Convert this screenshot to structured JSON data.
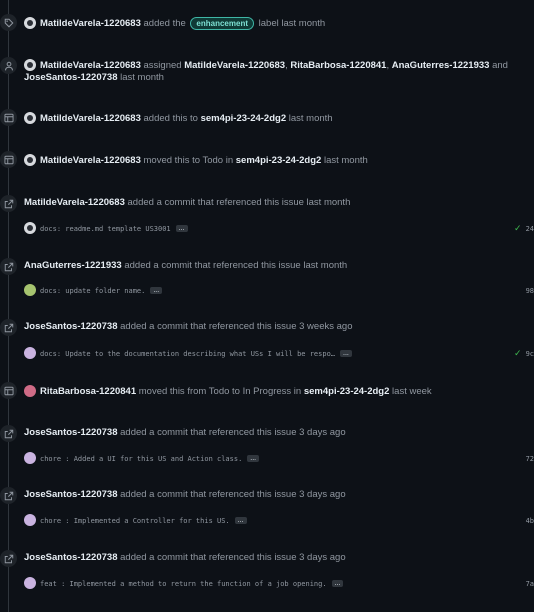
{
  "events": [
    {
      "type": "label",
      "user": "MatildeVarela-1220683",
      "pre": "added the",
      "label": "enhancement",
      "post": "label last month"
    },
    {
      "type": "assign",
      "user": "MatildeVarela-1220683",
      "pre": "assigned",
      "a1": "MatildeVarela-1220683",
      "a2": "RitaBarbosa-1220841",
      "a3": "AnaGuterres-1221933",
      "and": "and",
      "a4": "JoseSantos-1220738",
      "post": "last month"
    },
    {
      "type": "project",
      "user": "MatildeVarela-1220683",
      "pre": "added this to",
      "project": "sem4pi-23-24-2dg2",
      "post": "last month"
    },
    {
      "type": "project",
      "user": "MatildeVarela-1220683",
      "pre": "moved this to Todo in",
      "project": "sem4pi-23-24-2dg2",
      "post": "last month"
    },
    {
      "type": "commit",
      "user": "MatildeVarela-1220683",
      "text": "added a commit that referenced this issue last month",
      "commit_msg": "docs: readme.md template US3001",
      "dots": "...",
      "check": "✓",
      "sha": "24"
    },
    {
      "type": "commit",
      "user": "AnaGuterres-1221933",
      "text": "added a commit that referenced this issue last month",
      "commit_msg": "docs: update folder name.",
      "dots": "...",
      "sha": "98"
    },
    {
      "type": "commit",
      "user": "JoseSantos-1220738",
      "text": "added a commit that referenced this issue 3 weeks ago",
      "commit_msg": "docs: Update to the documentation describing what USs I will be respo…",
      "dots": "...",
      "check": "✓",
      "sha": "9c"
    },
    {
      "type": "project",
      "user": "RitaBarbosa-1220841",
      "pre": "moved this from Todo to In Progress in",
      "project": "sem4pi-23-24-2dg2",
      "post": "last week"
    },
    {
      "type": "commit",
      "user": "JoseSantos-1220738",
      "text": "added a commit that referenced this issue 3 days ago",
      "commit_msg": "chore : Added a UI for this US and Action class.",
      "dots": "...",
      "sha": "72"
    },
    {
      "type": "commit",
      "user": "JoseSantos-1220738",
      "text": "added a commit that referenced this issue 3 days ago",
      "commit_msg": "chore : Implemented a Controller for this US.",
      "dots": "...",
      "sha": "4b"
    },
    {
      "type": "commit",
      "user": "JoseSantos-1220738",
      "text": "added a commit that referenced this issue 3 days ago",
      "commit_msg": "feat : Implemented a method to return the function of a job opening.",
      "dots": "...",
      "sha": "7a"
    }
  ]
}
